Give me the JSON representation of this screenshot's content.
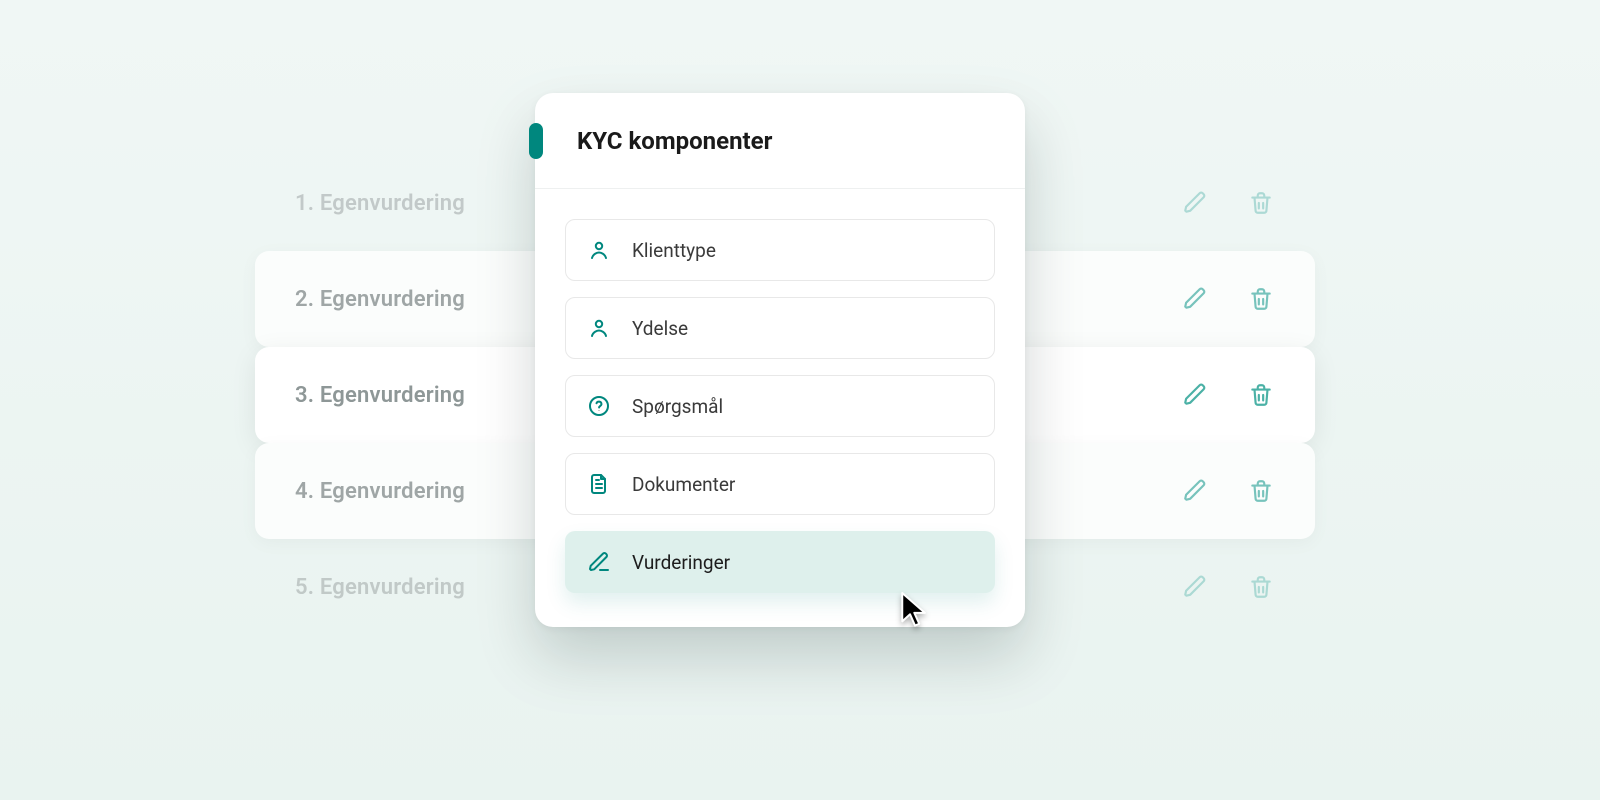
{
  "background_rows": [
    {
      "label": "1. Egenvurdering",
      "variant": "ghost"
    },
    {
      "label": "2. Egenvurdering",
      "variant": "card"
    },
    {
      "label": "3. Egenvurdering",
      "variant": "strong"
    },
    {
      "label": "4. Egenvurdering",
      "variant": "card"
    },
    {
      "label": "5. Egenvurdering",
      "variant": "ghost"
    }
  ],
  "panel": {
    "title": "KYC komponenter",
    "items": [
      {
        "icon": "person",
        "label": "Klienttype"
      },
      {
        "icon": "person",
        "label": "Ydelse"
      },
      {
        "icon": "help",
        "label": "Spørgsmål"
      },
      {
        "icon": "document",
        "label": "Dokumenter"
      },
      {
        "icon": "edit",
        "label": "Vurderinger",
        "selected": true
      }
    ]
  }
}
